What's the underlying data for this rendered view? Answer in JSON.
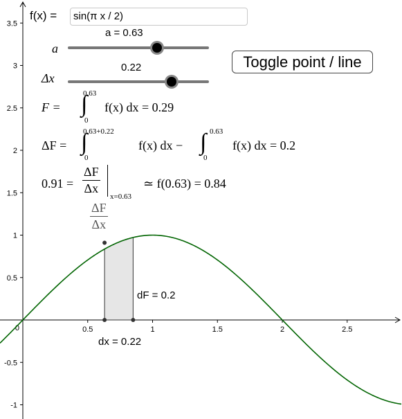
{
  "function_input": {
    "label": "f(x) =",
    "value": "sin(π x / 2)"
  },
  "slider_a": {
    "symbol": "a",
    "value_text": "a = 0.63",
    "value": 0.63,
    "min": 0,
    "max": 1
  },
  "slider_dx": {
    "symbol": "Δx",
    "value_text": "0.22",
    "value": 0.22,
    "min": 0,
    "max": 0.3
  },
  "toggle_button": {
    "label": "Toggle point / line"
  },
  "formulas": {
    "F": {
      "lhs": "F =",
      "upper": "0.63",
      "lower": "0",
      "body": "f(x) dx = 0.29"
    },
    "dF": {
      "lhs": "ΔF =",
      "upper1": "0.63+0.22",
      "lower1": "0",
      "body1": "f(x) dx −",
      "upper2": "0.63",
      "lower2": "0",
      "body2": "f(x) dx = 0.2"
    },
    "ratio": {
      "lhs": "0.91 =",
      "num": "ΔF",
      "den": "Δx",
      "eval_at": "x=0.63",
      "rhs": "≃ f(0.63) = 0.84"
    },
    "point_label": {
      "num": "ΔF",
      "den": "Δx"
    }
  },
  "graph": {
    "x_ticks": [
      "0.5",
      "1",
      "1.5",
      "2",
      "2.5"
    ],
    "y_ticks": [
      "3.5",
      "3",
      "2.5",
      "2",
      "1.5",
      "1",
      "0.5",
      "-0.5",
      "-1"
    ],
    "x_tick_values": [
      0.5,
      1,
      1.5,
      2,
      2.5
    ],
    "y_tick_values": [
      3.5,
      3,
      2.5,
      2,
      1.5,
      1,
      0.5,
      -0.5,
      -1
    ],
    "origin_label": "0",
    "curve_color": "#006400",
    "region_fill": "#e6e6e6",
    "a": 0.63,
    "dx": 0.22,
    "point_y": 0.91,
    "dF_label": "dF = 0.2",
    "dx_label": "dx = 0.22"
  }
}
